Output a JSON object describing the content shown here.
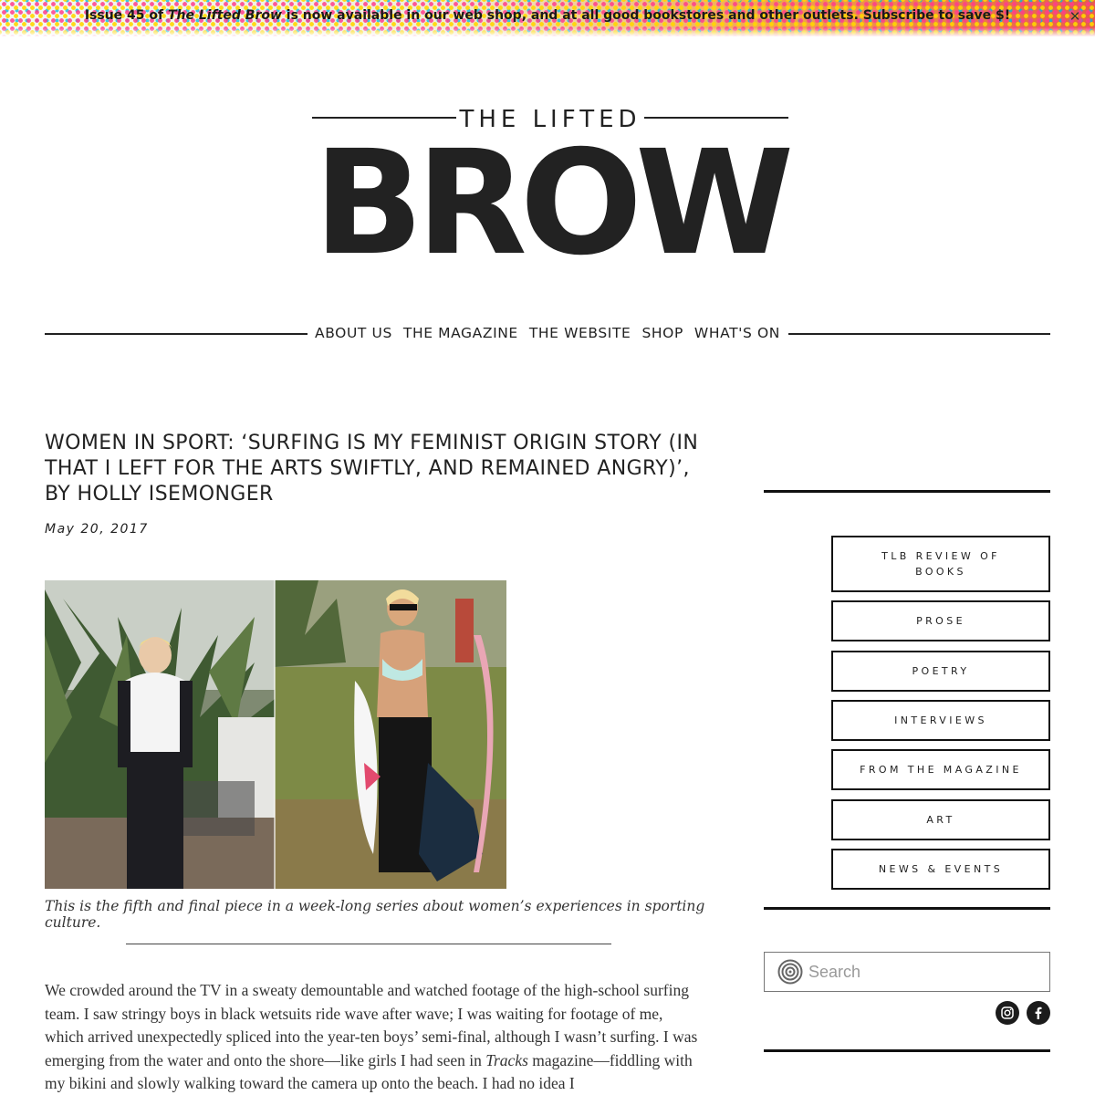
{
  "banner": {
    "prefix": "Issue 45 of ",
    "magazine": "The Lifted Brow",
    "suffix": " is now available in our web shop, and at all good bookstores and other outlets. Subscribe to save $!",
    "close_icon": "close-icon"
  },
  "logo": {
    "line1": "THE LIFTED",
    "line2": "BROW"
  },
  "nav": {
    "items": [
      {
        "label": "ABOUT US"
      },
      {
        "label": "THE MAGAZINE"
      },
      {
        "label": "THE WEBSITE"
      },
      {
        "label": "SHOP"
      },
      {
        "label": "WHAT'S ON"
      }
    ]
  },
  "article": {
    "title": "WOMEN IN SPORT: ‘SURFING IS MY FEMINIST ORIGIN STORY (IN THAT I LEFT FOR THE ARTS SWIFTLY, AND REMAINED ANGRY)’, BY HOLLY ISEMONGER",
    "date": "May 20, 2017",
    "caption": "This is the fifth and final piece in a week-long series about women’s experiences in sporting culture.",
    "body": {
      "part1": "We crowded around the TV in a sweaty demountable and watched footage of the high-school surfing team. I saw stringy boys in black wetsuits ride wave after wave; I was waiting for footage of me, which arrived unexpectedly spliced into the year-ten boys’ semi-final, although I wasn’t surfing. I was emerging from the water and onto the shore—like girls I had seen in ",
      "part2": "Tracks",
      "part3": " magazine—fiddling with my bikini and slowly walking toward the camera up onto the beach. I had no idea I"
    }
  },
  "sidebar": {
    "categories": [
      {
        "label": "TLB REVIEW OF BOOKS"
      },
      {
        "label": "PROSE"
      },
      {
        "label": "POETRY"
      },
      {
        "label": "INTERVIEWS"
      },
      {
        "label": "FROM THE MAGAZINE"
      },
      {
        "label": "ART"
      },
      {
        "label": "NEWS & EVENTS"
      }
    ],
    "search": {
      "placeholder": "Search",
      "icon": "search-icon"
    },
    "social": [
      {
        "icon": "instagram-icon"
      },
      {
        "icon": "facebook-icon"
      }
    ]
  }
}
